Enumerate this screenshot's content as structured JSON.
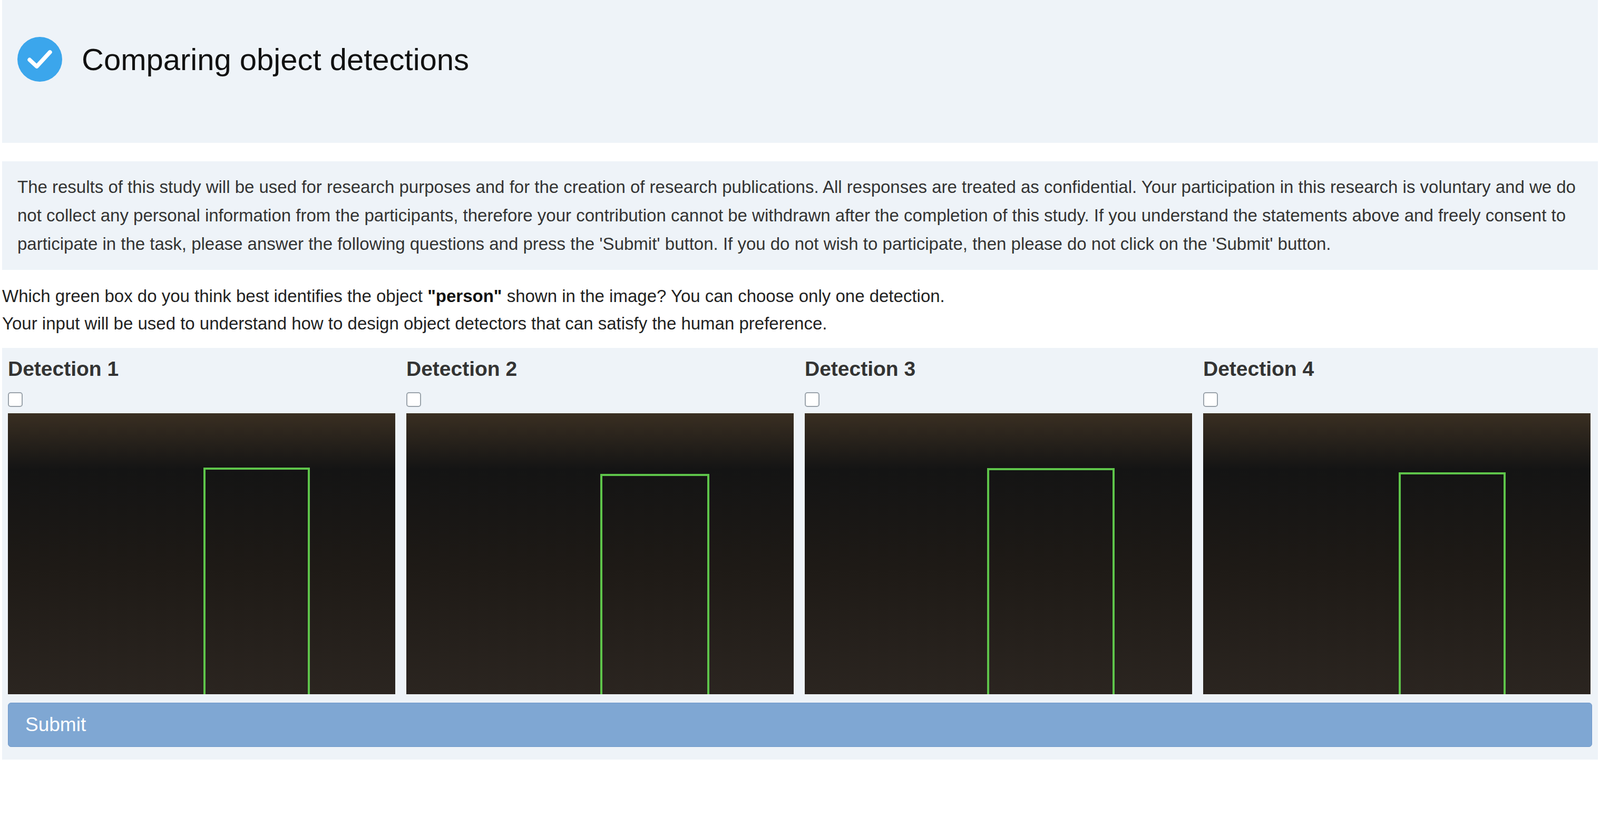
{
  "header": {
    "title": "Comparing object detections"
  },
  "consent": {
    "text": "The results of this study will be used for research purposes and for the creation of research publications. All responses are treated as confidential. Your participation in this research is voluntary and we do not collect any personal information from the participants, therefore your contribution cannot be withdrawn after the completion of this study. If you understand the statements above and freely consent to participate in the task, please answer the following questions and press the 'Submit' button. If you do not wish to participate, then please do not click on the 'Submit' button."
  },
  "question": {
    "before": "Which green box do you think best identifies the object ",
    "object": "\"person\"",
    "after": " shown in the image? You can choose only one detection.",
    "line2": "Your input will be used to understand how to design object detectors that can satisfy the human preference."
  },
  "detections": [
    {
      "label": "Detection 1",
      "checked": false
    },
    {
      "label": "Detection 2",
      "checked": false
    },
    {
      "label": "Detection 3",
      "checked": false
    },
    {
      "label": "Detection 4",
      "checked": false
    }
  ],
  "submit": {
    "label": "Submit",
    "disabled": true
  }
}
